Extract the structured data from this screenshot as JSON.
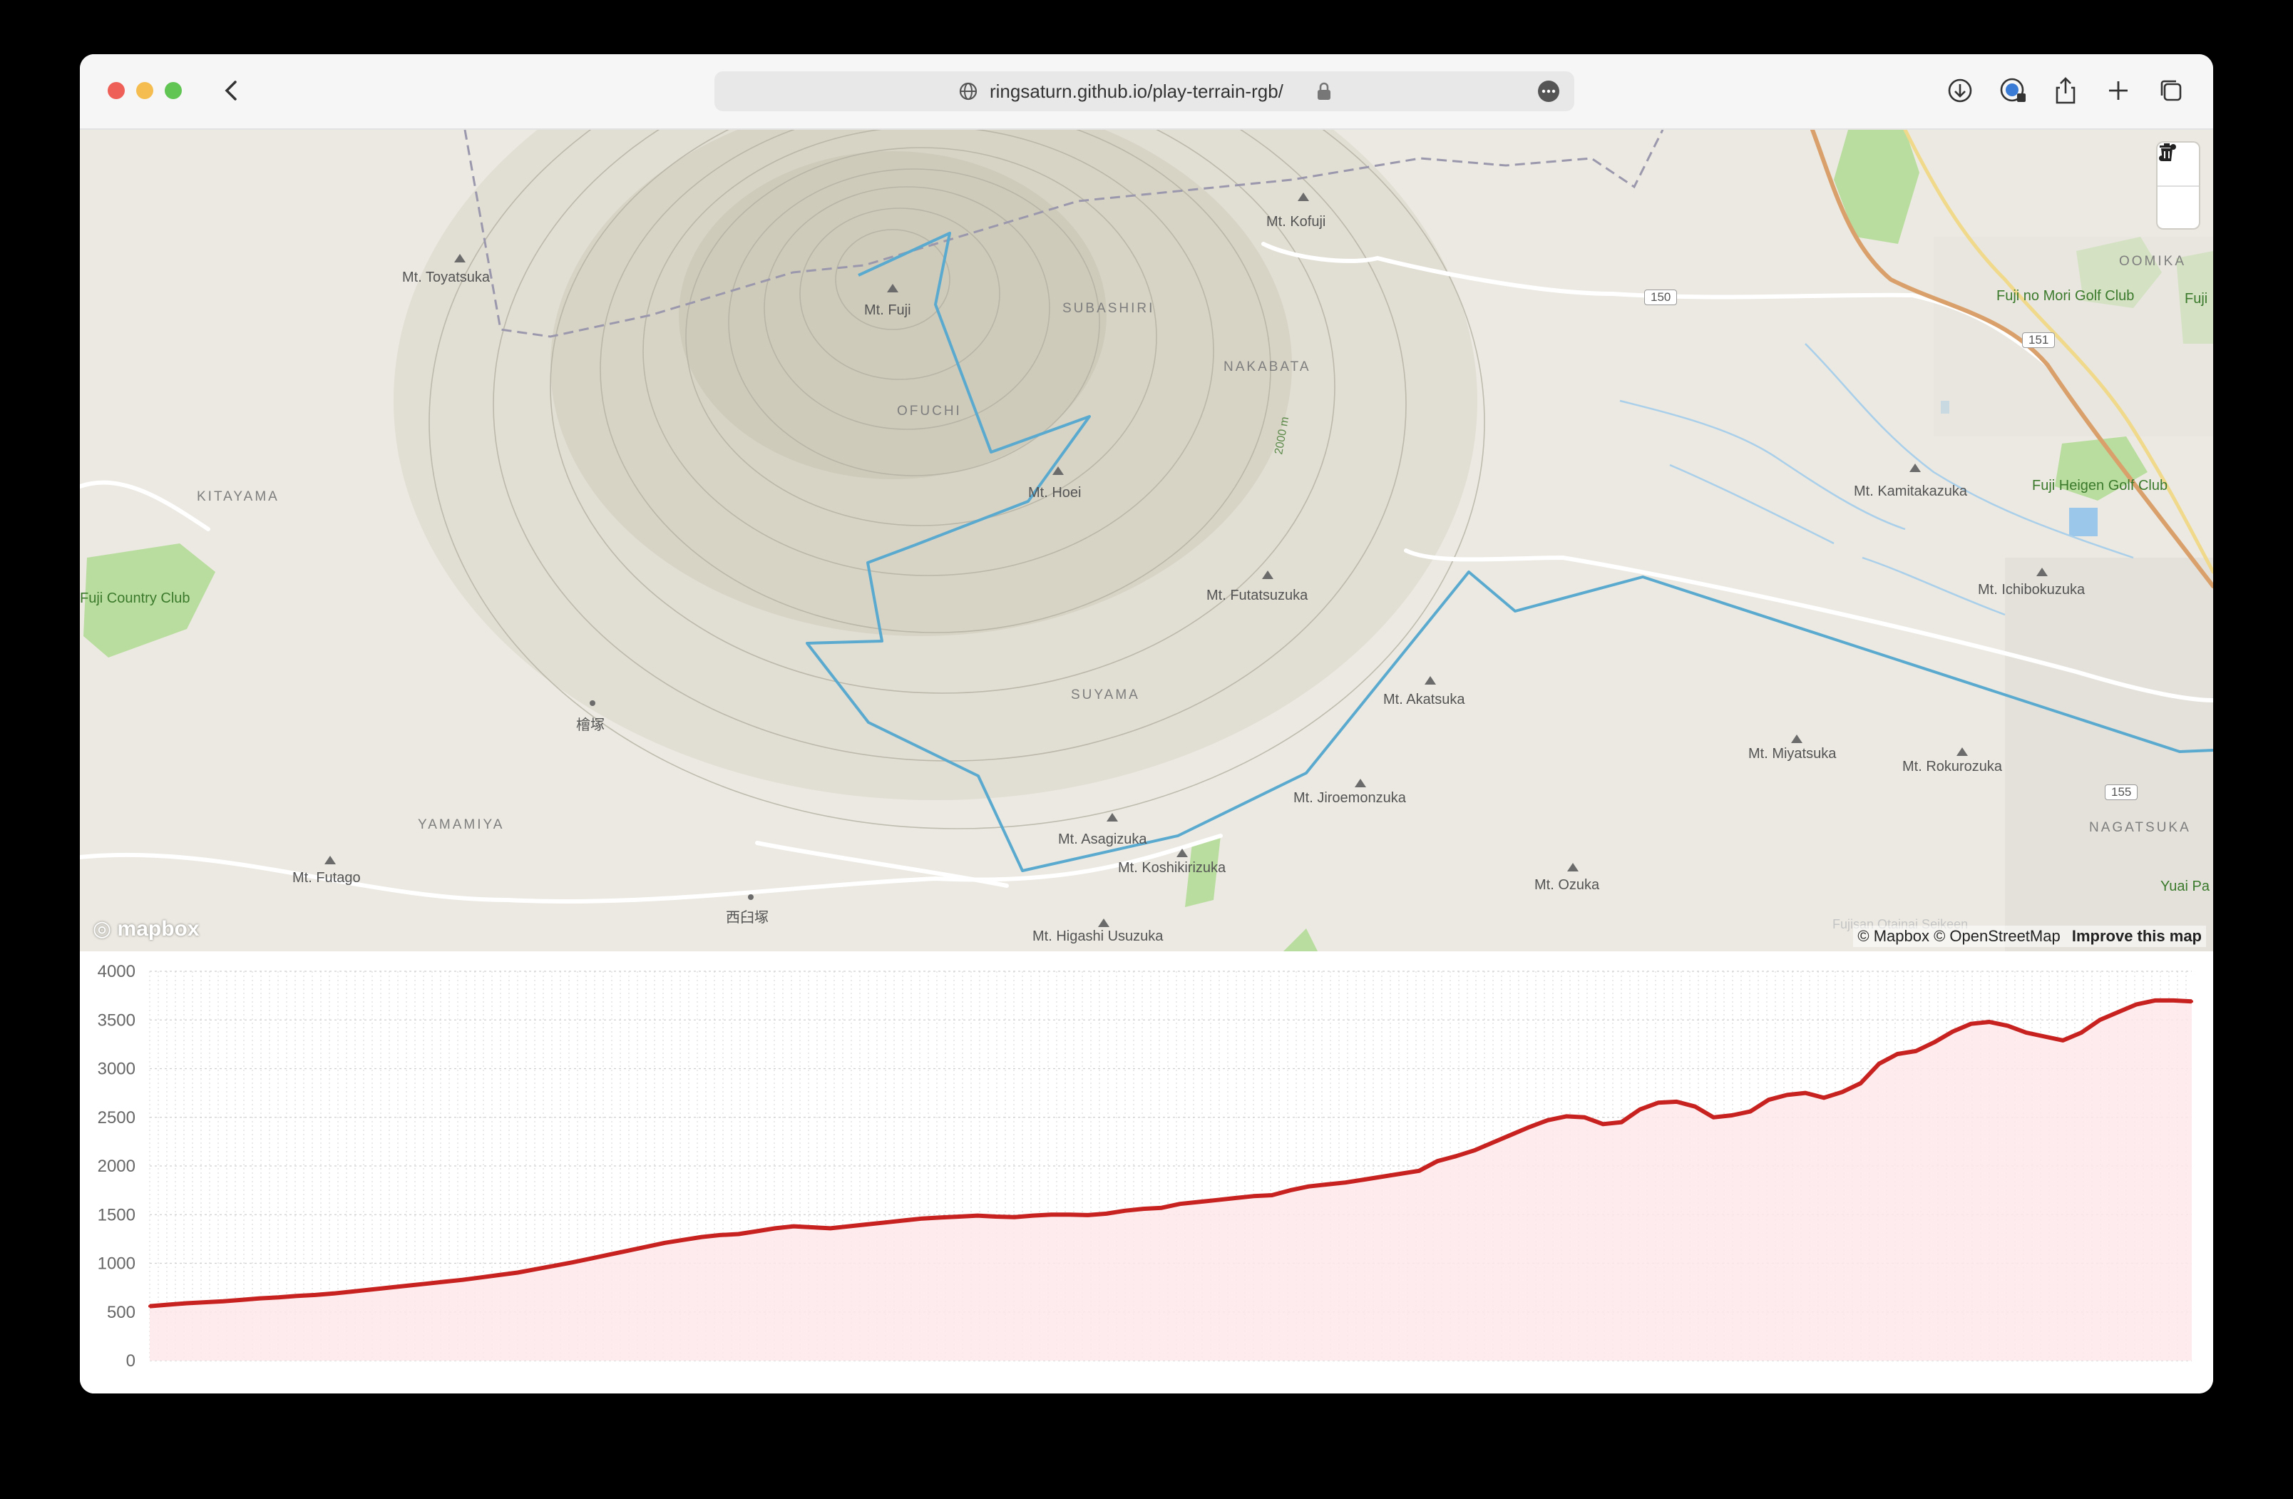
{
  "browser": {
    "url": "ringsaturn.github.io/play-terrain-rgb/",
    "icons": [
      "back-icon",
      "globe-icon",
      "lock-icon",
      "more-icon",
      "download-icon",
      "password-icon",
      "share-icon",
      "new-tab-icon",
      "tabs-icon"
    ]
  },
  "map": {
    "labels": {
      "mt_toyatsuka": "Mt. Toyatsuka",
      "mt_fuji": "Mt. Fuji",
      "subashiri": "SUBASHIRI",
      "mt_kofuji": "Mt. Kofuji",
      "nakabata": "NAKABATA",
      "ofuchi": "OFUCHI",
      "mt_hoei": "Mt. Hoei",
      "kitayama": "KITAYAMA",
      "fuji_country_club": "Fuji Country Club",
      "mt_futatsuzuka": "Mt. Futatsuzuka",
      "suyama": "SUYAMA",
      "mt_akatsuka": "Mt. Akatsuka",
      "hinokizuka": "檜塚",
      "yamamiya": "YAMAMIYA",
      "mt_jiroemonzuka": "Mt. Jiroemonzuka",
      "mt_asagizuka": "Mt. Asagizuka",
      "mt_koshikirizuka": "Mt. Koshikirizuka",
      "mt_futago": "Mt. Futago",
      "nishiusuzuka": "西臼塚",
      "mt_higashi_usuzuka": "Mt. Higashi Usuzuka",
      "mt_ozuka": "Mt. Ozuka",
      "mt_miyatsuka": "Mt. Miyatsuka",
      "mt_rokurozuka": "Mt. Rokurozuka",
      "nagatsuka": "NAGATSUKA",
      "mt_kamitakazuka": "Mt. Kamitakazuka",
      "mt_ichibokuzuka": "Mt. Ichibokuzuka",
      "oomika": "OOMIKA",
      "fuji_no_mori": "Fuji no Mori Golf Club",
      "fuji_heigen": "Fuji Heigen Golf Club",
      "fuji_partial": "Fuji",
      "yuai_pa": "Yuai Pa",
      "contour_2000": "2000 m",
      "route_150": "150",
      "route_151": "151",
      "route_155": "155",
      "faint_label": "Fujisan Otainai Seikeen"
    },
    "attribution": "© Mapbox © OpenStreetMap",
    "improve_link": "Improve this map",
    "logo": "mapbox",
    "controls": [
      "draw-line-icon",
      "trash-icon"
    ],
    "route_color": "#5aa9cf"
  },
  "chart_data": {
    "type": "area",
    "title": "",
    "xlabel": "",
    "ylabel": "",
    "ylim": [
      0,
      4000
    ],
    "yticks": [
      "4000",
      "3500",
      "3000",
      "2500",
      "2000",
      "1500",
      "1000",
      "500",
      "0"
    ],
    "line_color": "#c7221f",
    "fill_color": "#fde8ea",
    "grid": true,
    "values": [
      560,
      575,
      590,
      600,
      610,
      625,
      640,
      650,
      665,
      675,
      690,
      710,
      730,
      750,
      770,
      790,
      810,
      830,
      855,
      880,
      905,
      940,
      975,
      1010,
      1050,
      1090,
      1130,
      1170,
      1210,
      1240,
      1270,
      1290,
      1300,
      1330,
      1360,
      1380,
      1370,
      1360,
      1380,
      1400,
      1420,
      1440,
      1460,
      1470,
      1480,
      1490,
      1480,
      1475,
      1490,
      1500,
      1500,
      1495,
      1510,
      1540,
      1560,
      1570,
      1610,
      1630,
      1650,
      1670,
      1690,
      1700,
      1750,
      1790,
      1810,
      1830,
      1860,
      1890,
      1920,
      1950,
      2050,
      2100,
      2160,
      2240,
      2320,
      2400,
      2470,
      2510,
      2500,
      2430,
      2450,
      2580,
      2650,
      2660,
      2610,
      2500,
      2520,
      2560,
      2680,
      2730,
      2750,
      2700,
      2760,
      2850,
      3050,
      3150,
      3180,
      3270,
      3380,
      3460,
      3480,
      3440,
      3370,
      3330,
      3290,
      3370,
      3500,
      3580,
      3660,
      3700,
      3700,
      3690
    ]
  }
}
